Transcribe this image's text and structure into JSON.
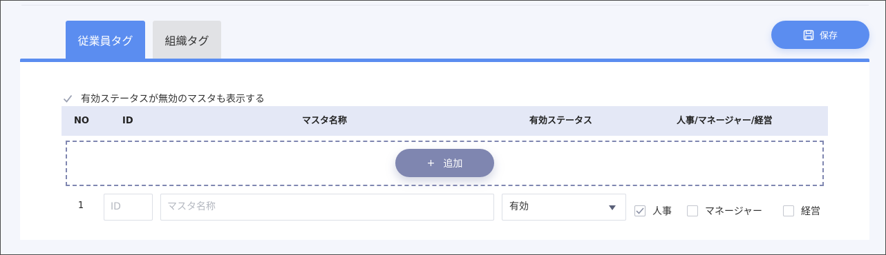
{
  "tabs": [
    {
      "label": "従業員タグ",
      "active": true
    },
    {
      "label": "組織タグ",
      "active": false
    }
  ],
  "toolbar": {
    "save_label": "保存",
    "save_icon": "floppy-disk-icon"
  },
  "filter": {
    "show_inactive_label": "有効ステータスが無効のマスタも表示する",
    "show_inactive_checked": true
  },
  "table": {
    "headers": [
      "NO",
      "ID",
      "マスタ名称",
      "有効ステータス",
      "人事/マネージャー/経営"
    ],
    "add_label": "追加",
    "add_icon": "+",
    "rows": [
      {
        "no": "1",
        "id_placeholder": "ID",
        "name_placeholder": "マスタ名称",
        "status": "有効",
        "roles": [
          {
            "label": "人事",
            "checked": true
          },
          {
            "label": "マネージャー",
            "checked": false
          },
          {
            "label": "経営",
            "checked": false
          }
        ]
      }
    ]
  },
  "colors": {
    "accent": "#5b8df0",
    "add_button": "#7f86b0",
    "header_bg": "#e4e8f6"
  }
}
